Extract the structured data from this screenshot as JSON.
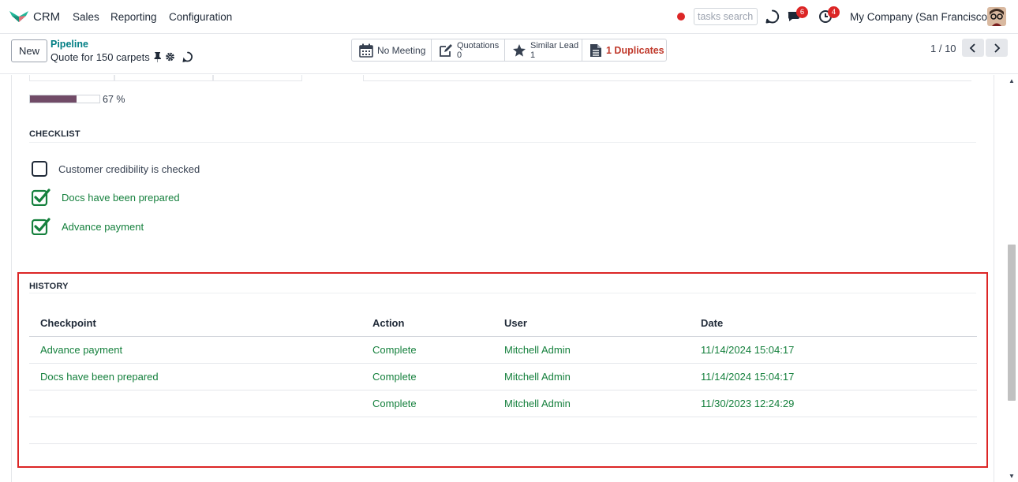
{
  "navbar": {
    "app_name": "CRM",
    "menu": [
      "Sales",
      "Reporting",
      "Configuration"
    ],
    "search_placeholder": "tasks search",
    "messages_count": "6",
    "activities_count": "4",
    "company": "My Company (San Francisco)"
  },
  "control_panel": {
    "new_label": "New",
    "breadcrumb_parent": "Pipeline",
    "breadcrumb_current": "Quote for 150 carpets",
    "smart_buttons": {
      "meeting": "No Meeting",
      "quotations_label": "Quotations",
      "quotations_value": "0",
      "similar_label": "Similar Lead",
      "similar_value": "1",
      "duplicates": "1 Duplicates"
    },
    "pager": "1 / 10"
  },
  "form": {
    "progress_percent": 67,
    "progress_label": "67 %",
    "checklist": {
      "title": "CHECKLIST",
      "items": [
        {
          "label": "Customer credibility is checked",
          "checked": false
        },
        {
          "label": "Docs have been prepared",
          "checked": true
        },
        {
          "label": "Advance payment",
          "checked": true
        }
      ]
    },
    "history": {
      "title": "HISTORY",
      "columns": [
        "Checkpoint",
        "Action",
        "User",
        "Date"
      ],
      "rows": [
        {
          "checkpoint": "Advance payment",
          "action": "Complete",
          "user": "Mitchell Admin",
          "date": "11/14/2024 15:04:17"
        },
        {
          "checkpoint": "Docs have been prepared",
          "action": "Complete",
          "user": "Mitchell Admin",
          "date": "11/14/2024 15:04:17"
        },
        {
          "checkpoint": "",
          "action": "Complete",
          "user": "Mitchell Admin",
          "date": "11/30/2023 12:24:29"
        }
      ]
    }
  },
  "colors": {
    "brand": "#714b67",
    "link": "#017e84",
    "success": "#15803d",
    "danger": "#dc2626"
  }
}
